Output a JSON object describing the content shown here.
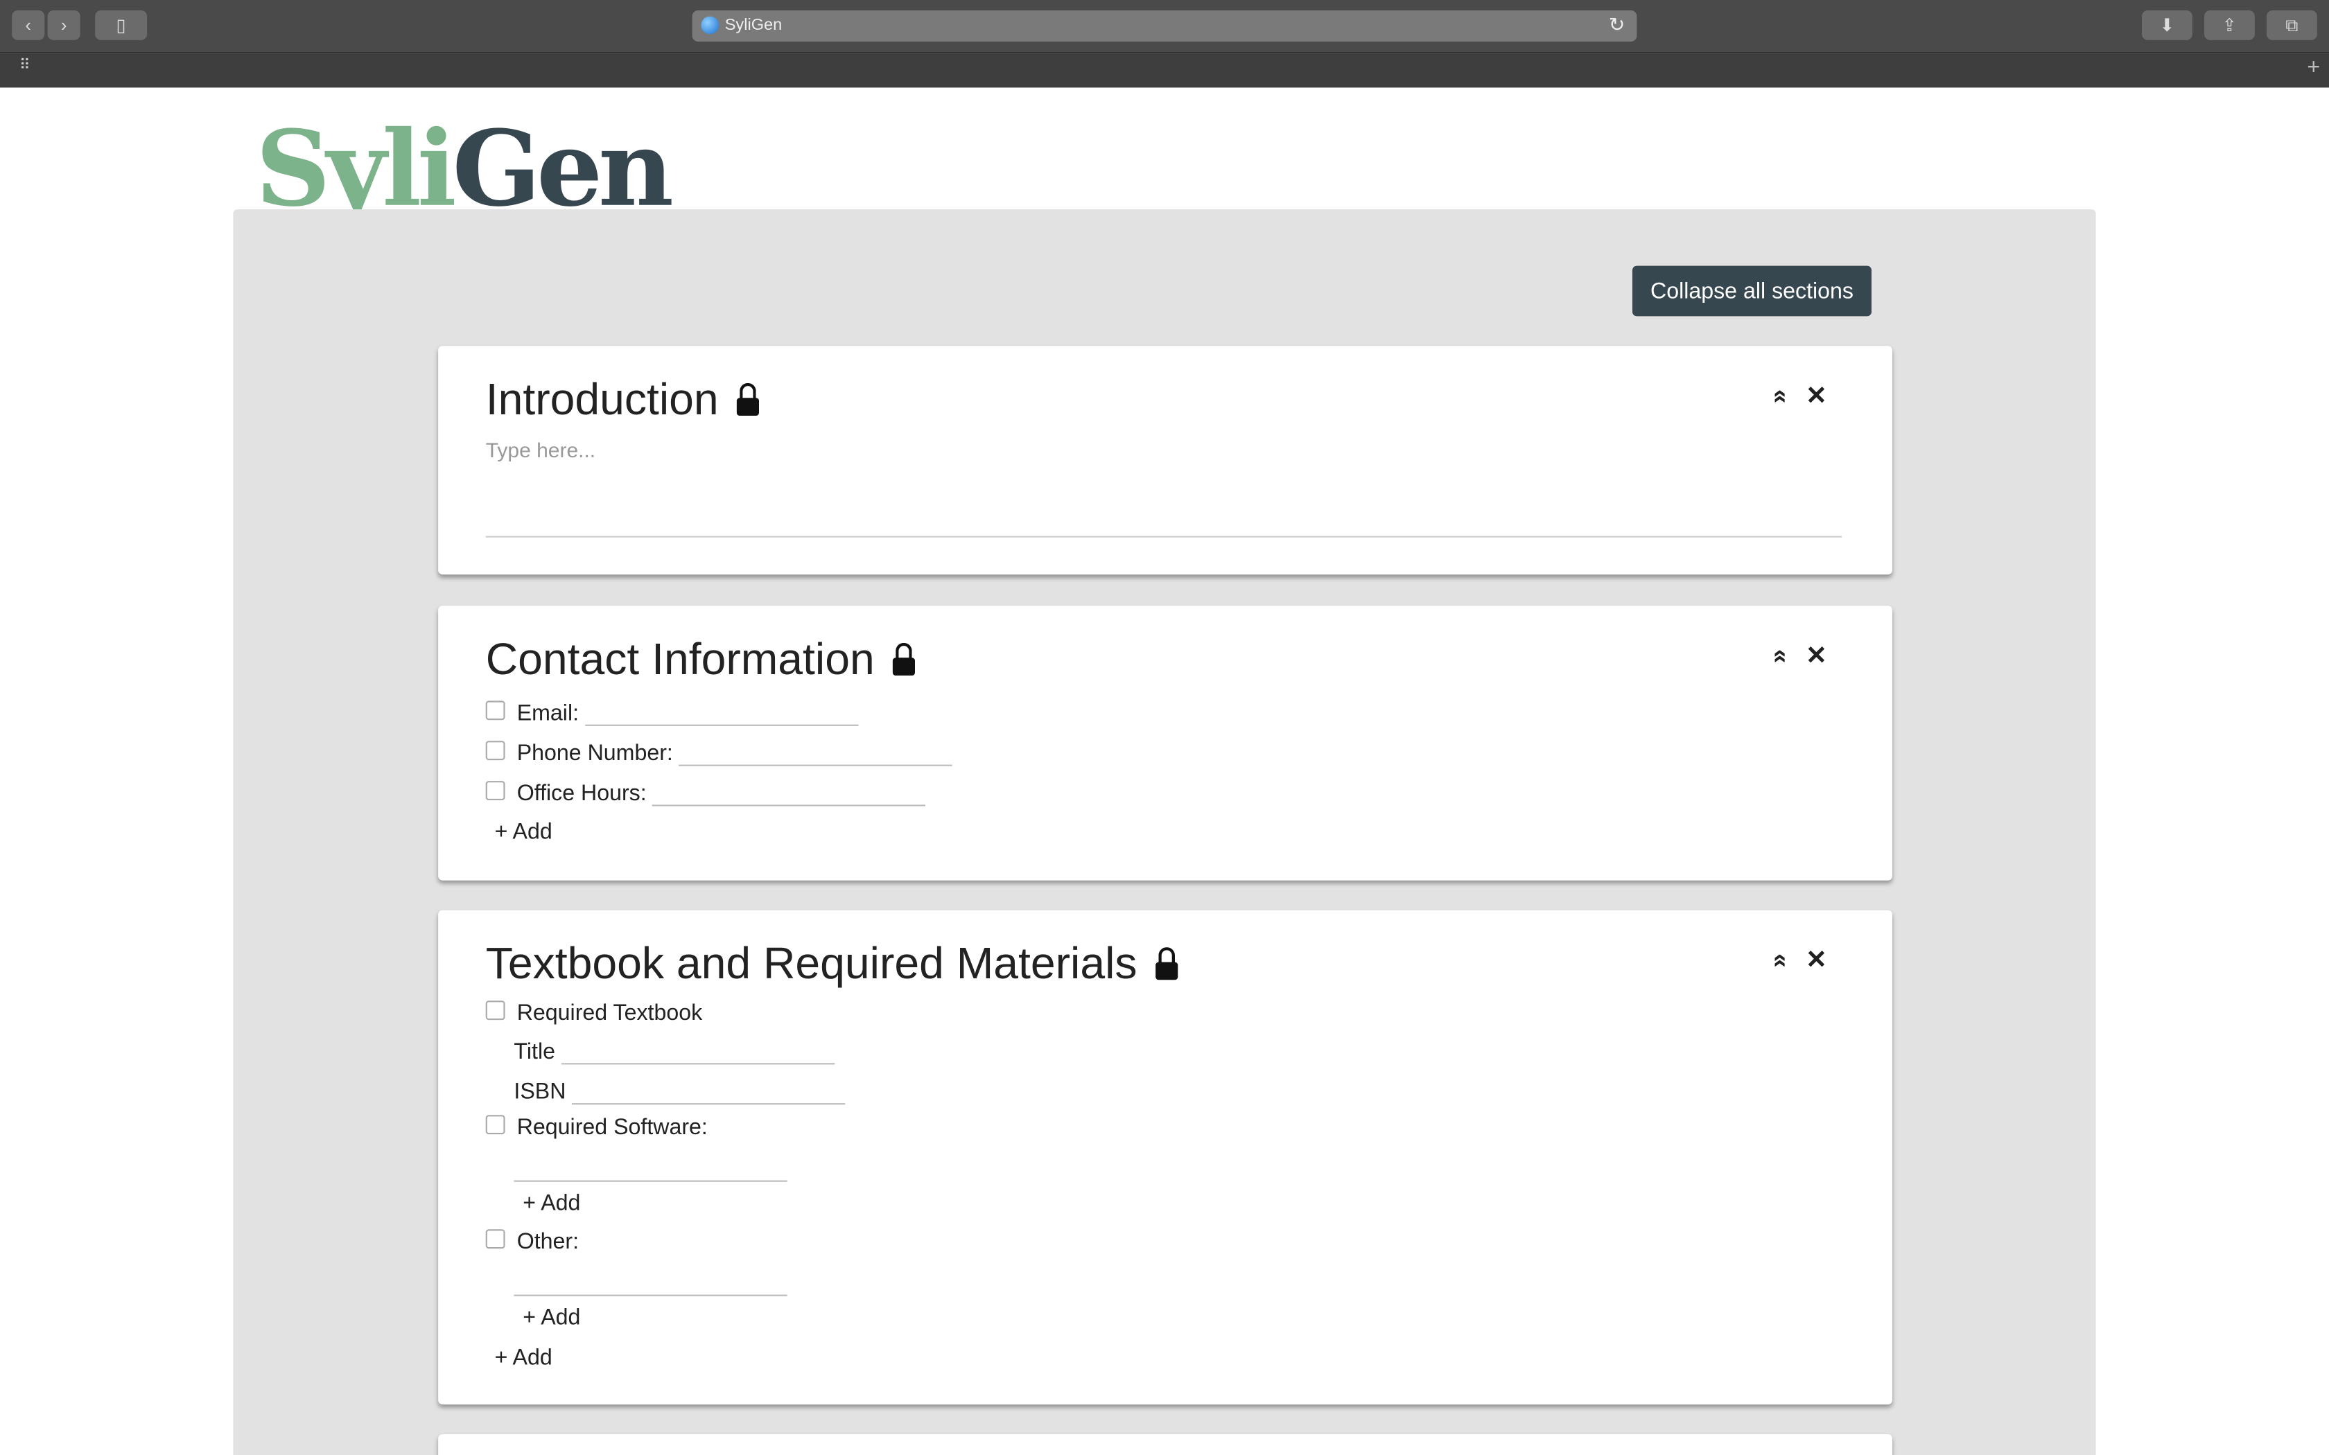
{
  "browser": {
    "url_title": "SyliGen",
    "icons": [
      "back-icon",
      "forward-icon",
      "sidebar-icon",
      "globe-icon",
      "reload-icon",
      "download-icon",
      "share-icon",
      "tabs-icon",
      "grid-icon",
      "new-tab-icon"
    ]
  },
  "logo": {
    "part1": "Syli",
    "part2": "Gen",
    "color1": "#7db38a",
    "color2": "#37474f"
  },
  "collapse_label": "Collapse all sections",
  "controls": {
    "collapse": "«",
    "close": "✕"
  },
  "sections": [
    {
      "title": "Introduction",
      "placeholder": "Type here..."
    },
    {
      "title": "Contact Information",
      "fields": [
        "Email:",
        "Phone Number:",
        "Office Hours:"
      ],
      "add": "+ Add"
    },
    {
      "title": "Textbook and Required Materials",
      "required_textbook": "Required Textbook",
      "title_label": "Title",
      "isbn_label": "ISBN",
      "software": "Required Software:",
      "other": "Other:",
      "add": "+ Add"
    }
  ]
}
